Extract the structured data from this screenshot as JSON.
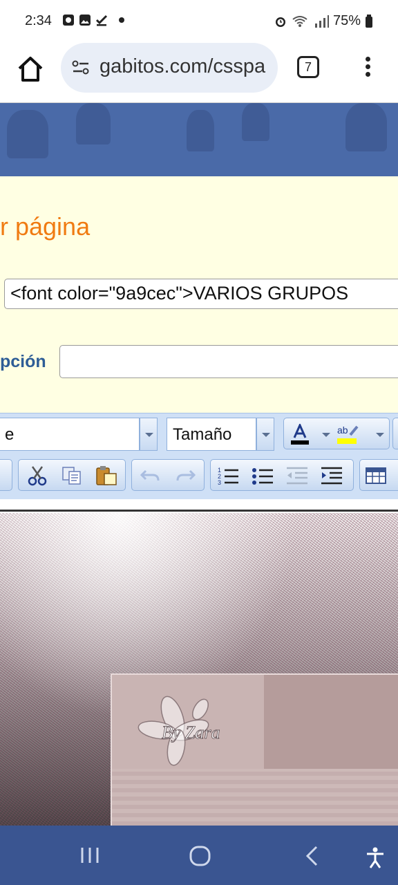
{
  "status_bar": {
    "time": "2:34",
    "battery": "75%"
  },
  "browser": {
    "url": "gabitos.com/csspa",
    "tab_count": "7"
  },
  "form": {
    "page_heading": "r página",
    "title_value": "<font color=\"9a9cec\">VARIOS GRUPOS",
    "description_label": "pción",
    "description_value": ""
  },
  "toolbar": {
    "font_select": "e",
    "size_select": "Tamaño",
    "text_color_hex": "#000000",
    "highlight_color_hex": "#ffff00"
  },
  "editor": {
    "watermark": "By Zara"
  },
  "colors": {
    "banner": "#4a6aa8",
    "form_bg": "#ffffe3",
    "heading": "#f07b12",
    "label": "#2e5d96",
    "navbar": "#3a5591"
  }
}
